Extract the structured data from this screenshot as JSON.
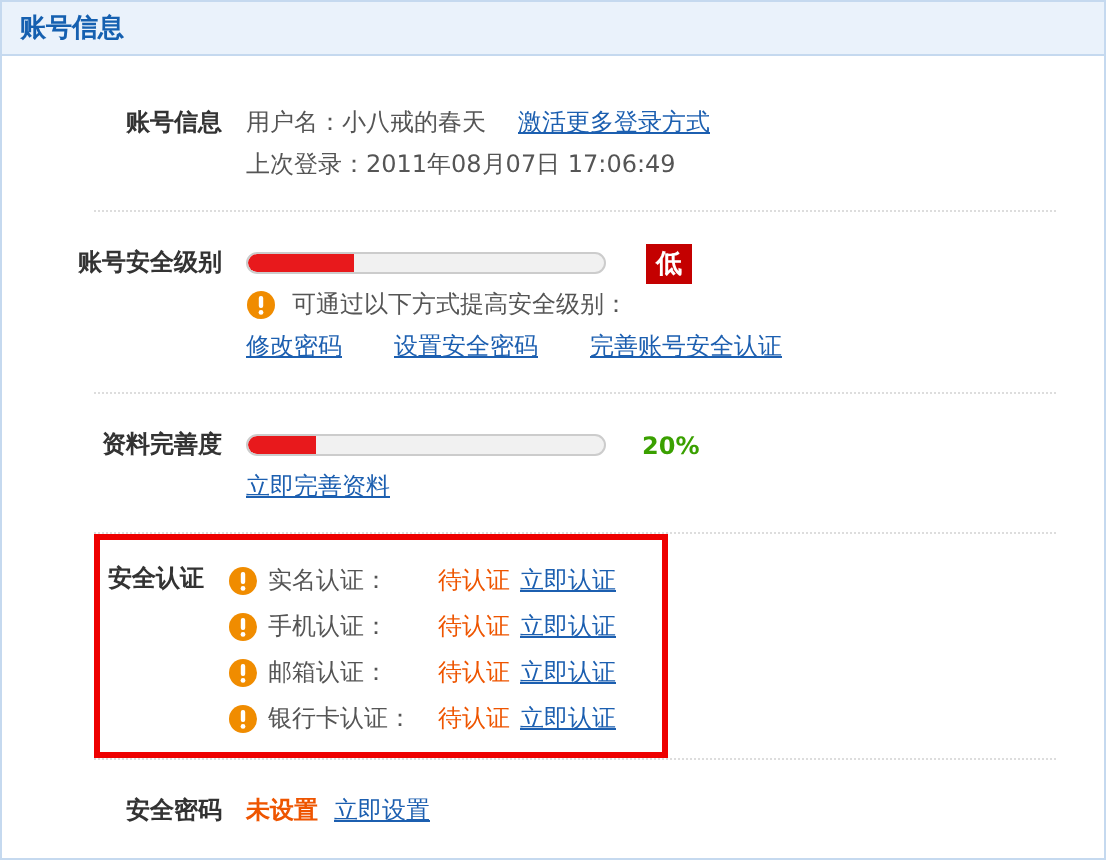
{
  "panel": {
    "title": "账号信息"
  },
  "account_info": {
    "label": "账号信息",
    "username": "用户名：小八戒的春天",
    "activate_link": "激活更多登录方式",
    "last_login": "上次登录：2011年08月07日 17:06:49"
  },
  "security_level": {
    "label": "账号安全级别",
    "level": 0.3,
    "badge": "低",
    "hint": "可通过以下方式提高安全级别：",
    "links": [
      "修改密码",
      "设置安全密码",
      "完善账号安全认证"
    ]
  },
  "completeness": {
    "label": "资料完善度",
    "level": 0.19,
    "percent": "20%",
    "link": "立即完善资料"
  },
  "verification": {
    "label": "安全认证",
    "highlighted": true,
    "items": [
      {
        "name": "实名认证：",
        "status": "待认证",
        "action": "立即认证"
      },
      {
        "name": "手机认证：",
        "status": "待认证",
        "action": "立即认证"
      },
      {
        "name": "邮箱认证：",
        "status": "待认证",
        "action": "立即认证"
      },
      {
        "name": "银行卡认证：",
        "status": "待认证",
        "action": "立即认证"
      }
    ]
  },
  "security_password": {
    "label": "安全密码",
    "status": "未设置",
    "action": "立即设置"
  }
}
